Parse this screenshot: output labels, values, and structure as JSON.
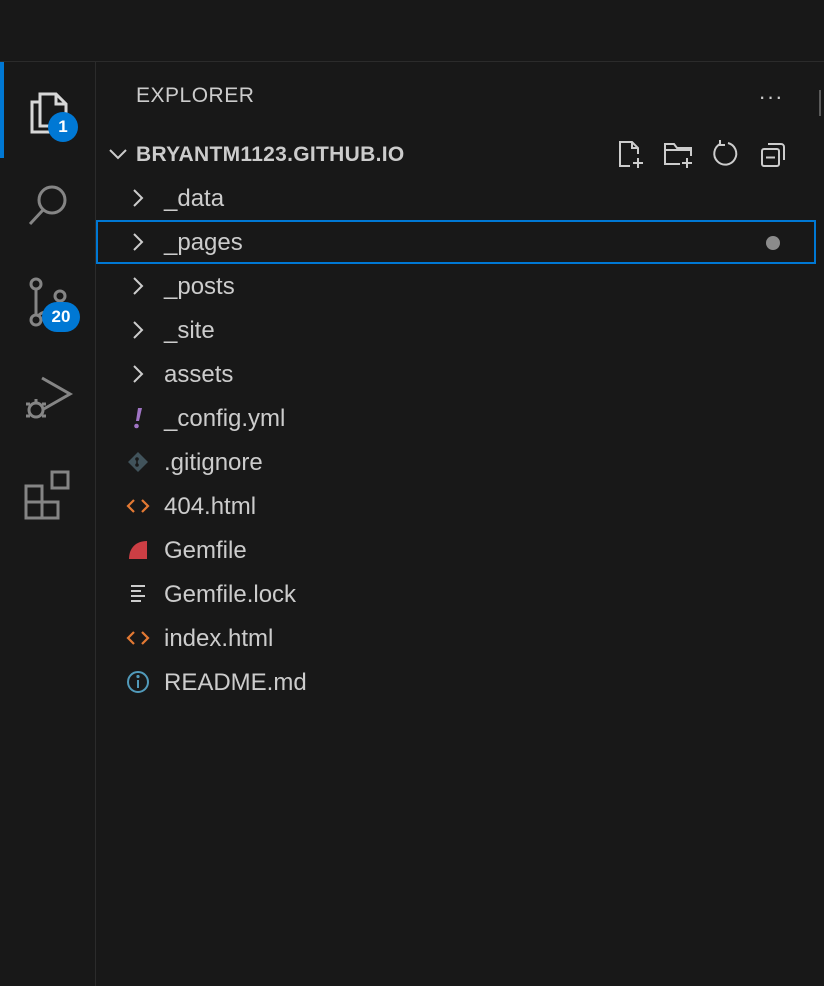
{
  "activity_bar": {
    "explorer_badge": "1",
    "source_control_badge": "20"
  },
  "sidebar": {
    "title": "EXPLORER",
    "more_label": "···",
    "folder_name": "BRYANTM1123.GITHUB.IO",
    "items": [
      {
        "label": "_data",
        "type": "folder"
      },
      {
        "label": "_pages",
        "type": "folder",
        "modified": true
      },
      {
        "label": "_posts",
        "type": "folder"
      },
      {
        "label": "_site",
        "type": "folder"
      },
      {
        "label": "assets",
        "type": "folder"
      },
      {
        "label": "_config.yml",
        "type": "file",
        "icon": "yaml-icon"
      },
      {
        "label": ".gitignore",
        "type": "file",
        "icon": "git-icon"
      },
      {
        "label": "404.html",
        "type": "file",
        "icon": "html-icon"
      },
      {
        "label": "Gemfile",
        "type": "file",
        "icon": "ruby-icon"
      },
      {
        "label": "Gemfile.lock",
        "type": "file",
        "icon": "lines-icon"
      },
      {
        "label": "index.html",
        "type": "file",
        "icon": "html-icon"
      },
      {
        "label": "README.md",
        "type": "file",
        "icon": "info-icon"
      }
    ]
  },
  "colors": {
    "background": "#181818",
    "accent": "#0078d4",
    "text": "#cccccc",
    "html_icon": "#e37933",
    "yaml_icon": "#a074c4",
    "ruby_icon": "#cc3e44",
    "info_icon": "#519aba"
  }
}
